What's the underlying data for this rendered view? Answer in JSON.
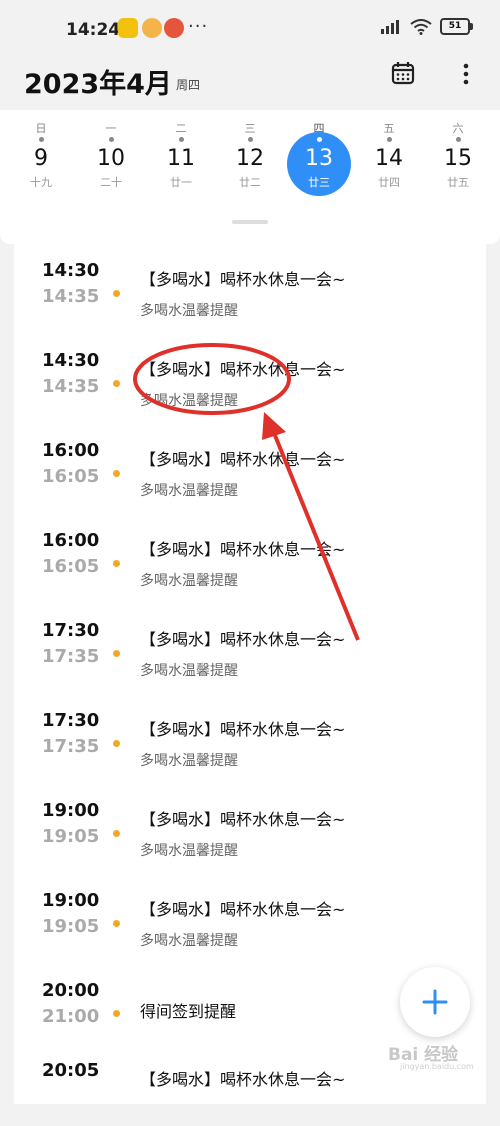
{
  "status_bar": {
    "time": "14:24",
    "dots": "···",
    "battery": "51"
  },
  "header": {
    "title": "2023年4月",
    "weekday": "周四",
    "calendar_icon": "calendar-icon",
    "more_icon": "more-vertical-icon"
  },
  "week": [
    {
      "weekday": "日",
      "day": "9",
      "lunar": "十九",
      "selected": false
    },
    {
      "weekday": "一",
      "day": "10",
      "lunar": "二十",
      "selected": false
    },
    {
      "weekday": "二",
      "day": "11",
      "lunar": "廿一",
      "selected": false
    },
    {
      "weekday": "三",
      "day": "12",
      "lunar": "廿二",
      "selected": false
    },
    {
      "weekday": "四",
      "day": "13",
      "lunar": "廿三",
      "selected": true
    },
    {
      "weekday": "五",
      "day": "14",
      "lunar": "廿四",
      "selected": false
    },
    {
      "weekday": "六",
      "day": "15",
      "lunar": "廿五",
      "selected": false
    }
  ],
  "events": [
    {
      "start": "14:30",
      "end": "14:35",
      "title": "【多喝水】喝杯水休息一会~",
      "subtitle": "多喝水温馨提醒"
    },
    {
      "start": "14:30",
      "end": "14:35",
      "title": "【多喝水】喝杯水休息一会~",
      "subtitle": "多喝水温馨提醒"
    },
    {
      "start": "16:00",
      "end": "16:05",
      "title": "【多喝水】喝杯水休息一会~",
      "subtitle": "多喝水温馨提醒"
    },
    {
      "start": "16:00",
      "end": "16:05",
      "title": "【多喝水】喝杯水休息一会~",
      "subtitle": "多喝水温馨提醒"
    },
    {
      "start": "17:30",
      "end": "17:35",
      "title": "【多喝水】喝杯水休息一会~",
      "subtitle": "多喝水温馨提醒"
    },
    {
      "start": "17:30",
      "end": "17:35",
      "title": "【多喝水】喝杯水休息一会~",
      "subtitle": "多喝水温馨提醒"
    },
    {
      "start": "19:00",
      "end": "19:05",
      "title": "【多喝水】喝杯水休息一会~",
      "subtitle": "多喝水温馨提醒"
    },
    {
      "start": "19:00",
      "end": "19:05",
      "title": "【多喝水】喝杯水休息一会~",
      "subtitle": "多喝水温馨提醒"
    },
    {
      "start": "20:00",
      "end": "21:00",
      "title": "得间签到提醒",
      "subtitle": ""
    },
    {
      "start": "20:05",
      "end": "",
      "title": "【多喝水】喝杯水休息一会~",
      "subtitle": ""
    }
  ],
  "fab": {
    "icon": "plus-icon"
  },
  "colors": {
    "accent": "#2f8ff7",
    "event_dot": "#f5a623",
    "annotation": "#e0302a"
  },
  "watermark": {
    "text": "Bai 经验",
    "sub": "jingyan.baidu.com"
  }
}
